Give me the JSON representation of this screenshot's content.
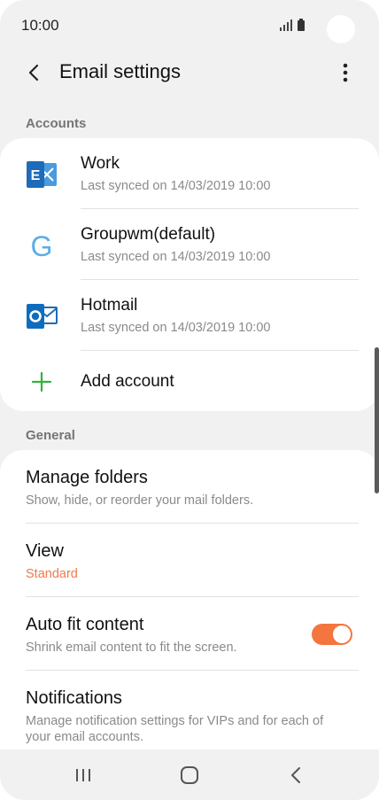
{
  "status_bar": {
    "time": "10:00"
  },
  "header": {
    "title": "Email settings"
  },
  "sections": {
    "accounts": "Accounts",
    "general": "General"
  },
  "accounts": [
    {
      "name": "Work",
      "last_synced": "Last synced on 14/03/2019  10:00",
      "icon": "exchange-icon"
    },
    {
      "name": "Groupwm(default)",
      "last_synced": "Last synced on 14/03/2019  10:00",
      "icon": "google-g-icon"
    },
    {
      "name": "Hotmail",
      "last_synced": "Last synced on 14/03/2019  10:00",
      "icon": "outlook-icon"
    }
  ],
  "add_account": {
    "label": "Add account"
  },
  "general": {
    "manage_folders": {
      "title": "Manage folders",
      "subtitle": "Show, hide, or reorder your mail folders."
    },
    "view": {
      "title": "View",
      "value": "Standard"
    },
    "auto_fit": {
      "title": "Auto fit content",
      "subtitle": "Shrink email content to fit the screen.",
      "enabled": true
    },
    "notifications": {
      "title": "Notifications",
      "subtitle": "Manage notification settings for VIPs and for each of your email accounts."
    }
  },
  "colors": {
    "accent": "#f4753e",
    "add_icon": "#2db33e",
    "exchange": "#1e6bb8",
    "outlook": "#0f6cbd",
    "google_g": "#5aaee6"
  }
}
